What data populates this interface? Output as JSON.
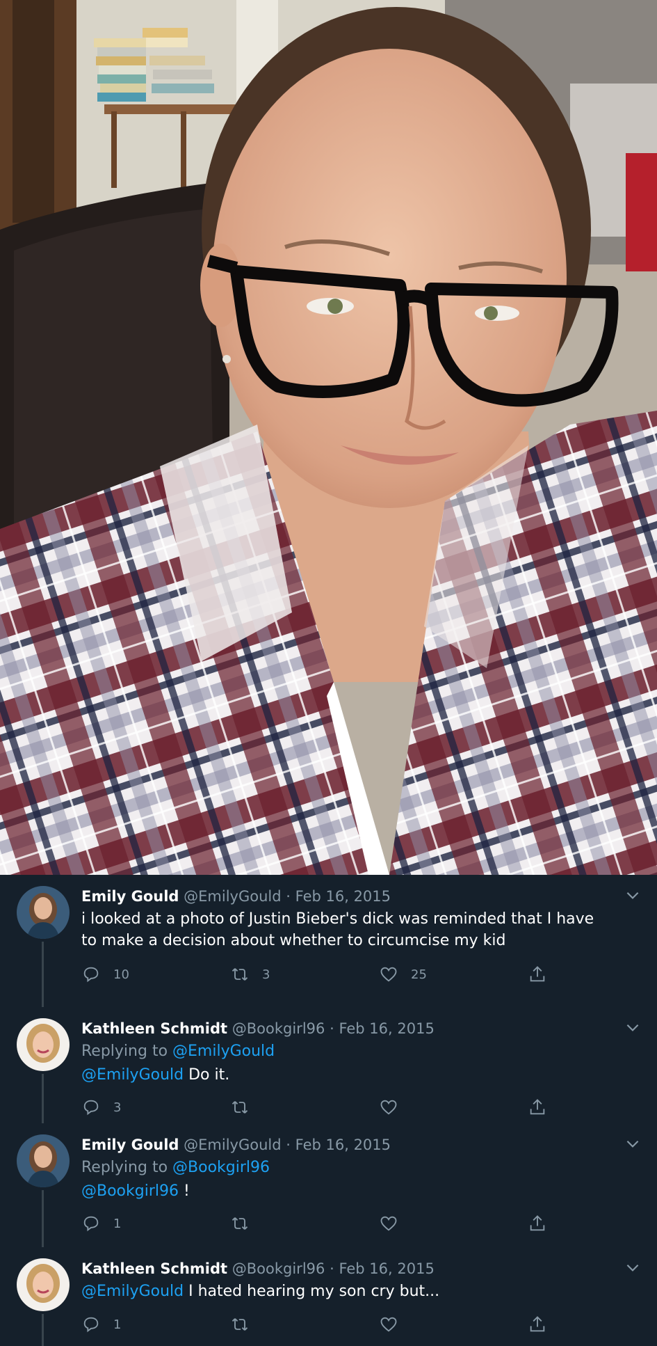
{
  "photo": {
    "alt_subject": "selfie"
  },
  "tweets": [
    {
      "name": "Emily Gould",
      "handle": "@EmilyGould",
      "sep": "·",
      "date": "Feb 16, 2015",
      "text": "i looked at a photo of Justin Bieber's dick was reminded that I have to make a decision about whether to circumcise my kid",
      "replies": "10",
      "retweets": "3",
      "likes": "25"
    },
    {
      "name": "Kathleen Schmidt",
      "handle": "@Bookgirl96",
      "sep": "·",
      "date": "Feb 16, 2015",
      "replying_label": "Replying to",
      "replying_to": "@EmilyGould",
      "mention": "@EmilyGould",
      "text": " Do it.",
      "replies": "3",
      "retweets": "",
      "likes": ""
    },
    {
      "name": "Emily Gould",
      "handle": "@EmilyGould",
      "sep": "·",
      "date": "Feb 16, 2015",
      "replying_label": "Replying to",
      "replying_to": "@Bookgirl96",
      "mention": "@Bookgirl96",
      "text": " !",
      "replies": "1",
      "retweets": "",
      "likes": ""
    },
    {
      "name": "Kathleen Schmidt",
      "handle": "@Bookgirl96",
      "sep": "·",
      "date": "Feb 16, 2015",
      "mention": "@EmilyGould",
      "text": " I hated hearing my son cry but...",
      "replies": "1",
      "retweets": "",
      "likes": ""
    }
  ],
  "colors": {
    "background": "#15202b",
    "secondary_text": "#8899a6",
    "link": "#1da1f2",
    "thread_line": "#38444d"
  },
  "icons": [
    "reply-icon",
    "retweet-icon",
    "like-icon",
    "share-icon",
    "chevron-down-icon"
  ]
}
